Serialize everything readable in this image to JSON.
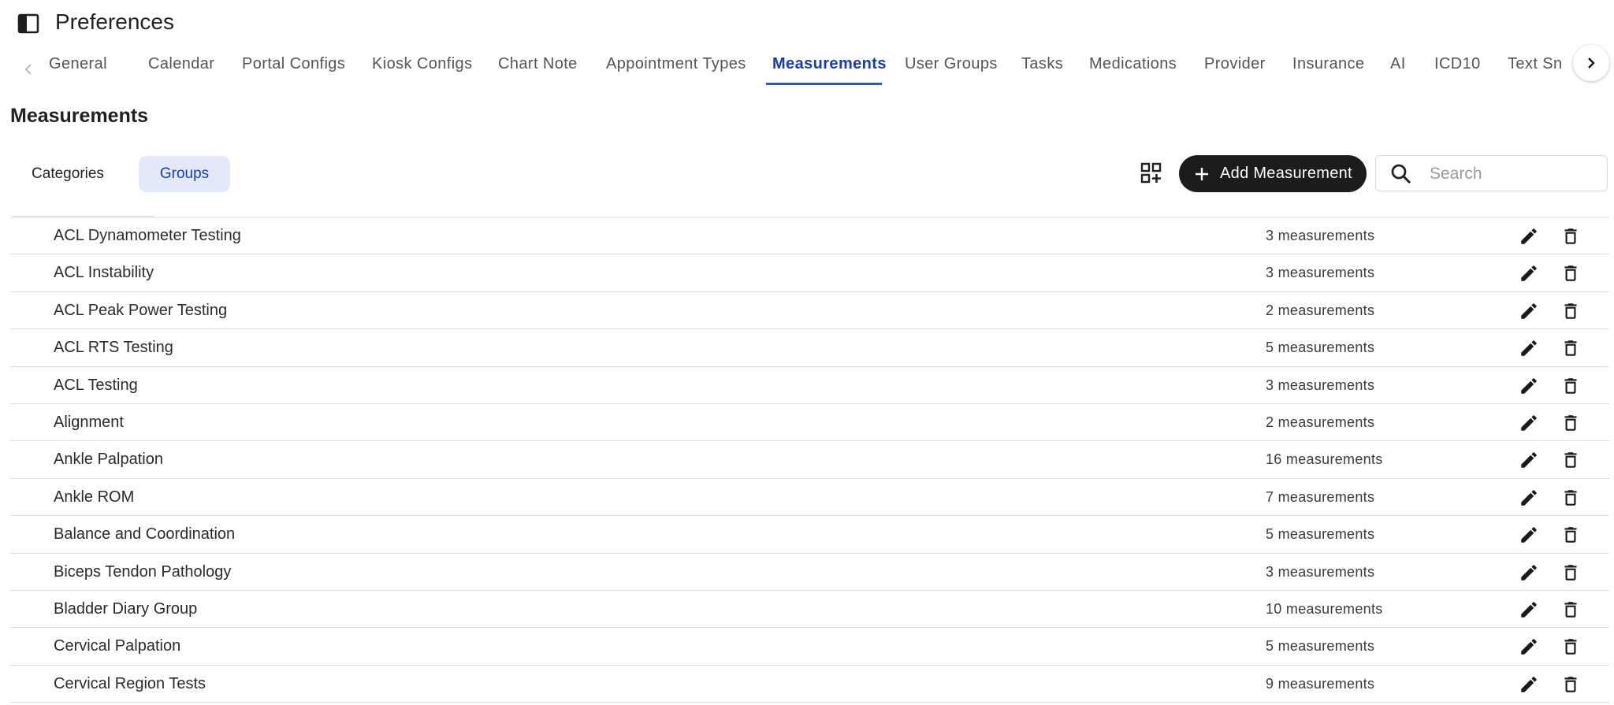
{
  "header": {
    "title": "Preferences",
    "panel_icon": "side-panel-icon"
  },
  "tabs": [
    {
      "label": "General"
    },
    {
      "label": "Calendar"
    },
    {
      "label": "Portal Configs"
    },
    {
      "label": "Kiosk Configs"
    },
    {
      "label": "Chart Note"
    },
    {
      "label": "Appointment Types"
    },
    {
      "label": "Measurements",
      "active": true
    },
    {
      "label": "User Groups"
    },
    {
      "label": "Tasks"
    },
    {
      "label": "Medications"
    },
    {
      "label": "Provider"
    },
    {
      "label": "Insurance"
    },
    {
      "label": "AI"
    },
    {
      "label": "ICD10"
    },
    {
      "label": "Text Sni"
    }
  ],
  "section": {
    "title": "Measurements"
  },
  "segments": {
    "categories": "Categories",
    "groups": "Groups",
    "selected": "Groups"
  },
  "toolbar": {
    "add_label": "Add Measurement",
    "search_placeholder": "Search",
    "search_value": ""
  },
  "colors": {
    "accent": "#1a3ea8",
    "selected_segment_bg": "#e4e8fb",
    "button_bg": "#1c1c1c"
  },
  "rows": [
    {
      "name": "ACL Dynamometer Testing",
      "count": "3 measurements"
    },
    {
      "name": "ACL Instability",
      "count": "3 measurements"
    },
    {
      "name": "ACL Peak Power Testing",
      "count": "2 measurements"
    },
    {
      "name": "ACL RTS Testing",
      "count": "5 measurements"
    },
    {
      "name": "ACL Testing",
      "count": "3 measurements"
    },
    {
      "name": "Alignment",
      "count": "2 measurements"
    },
    {
      "name": "Ankle Palpation",
      "count": "16 measurements"
    },
    {
      "name": "Ankle ROM",
      "count": "7 measurements"
    },
    {
      "name": "Balance and Coordination",
      "count": "5 measurements"
    },
    {
      "name": "Biceps Tendon Pathology",
      "count": "3 measurements"
    },
    {
      "name": "Bladder Diary Group",
      "count": "10 measurements"
    },
    {
      "name": "Cervical Palpation",
      "count": "5 measurements"
    },
    {
      "name": "Cervical Region Tests",
      "count": "9 measurements"
    }
  ]
}
